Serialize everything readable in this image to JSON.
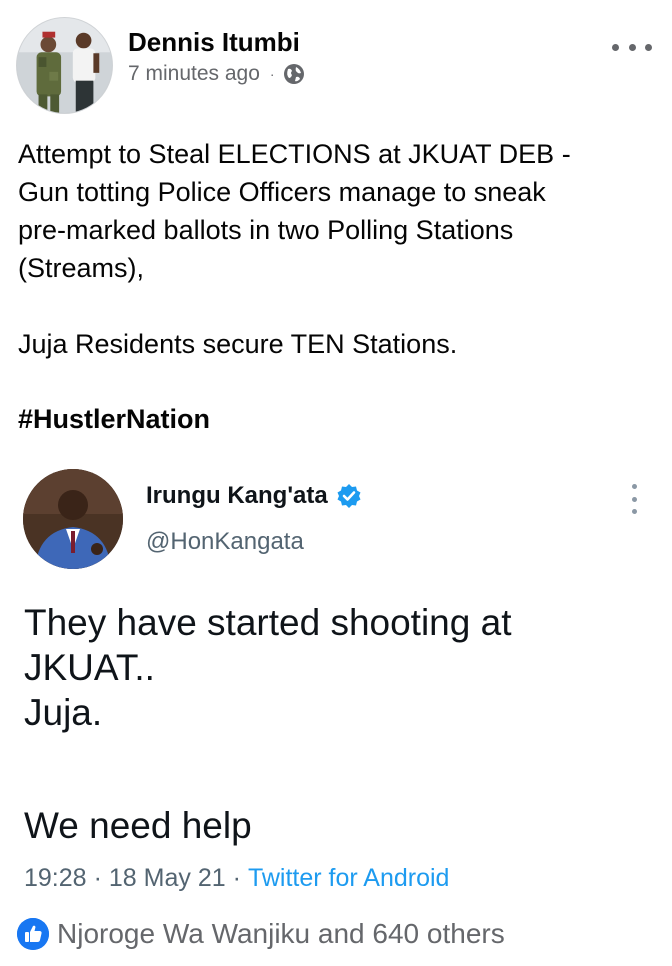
{
  "post": {
    "author": "Dennis Itumbi",
    "timestamp": "7 minutes ago",
    "separator": "·",
    "privacy_icon": "globe-icon",
    "text_lines": [
      "Attempt to Steal ELECTIONS at JKUAT DEB -",
      "Gun totting Police Officers manage to sneak",
      "pre-marked ballots in two Polling Stations",
      "(Streams),"
    ],
    "text_line2": "Juja Residents secure TEN Stations.",
    "hashtag": "#HustlerNation"
  },
  "tweet": {
    "name": "Irungu Kang'ata",
    "handle": "@HonKangata",
    "body_lines": [
      "They have started shooting at",
      "JKUAT..",
      "Juja."
    ],
    "body_last": "We need help",
    "time": "19:28",
    "date": "18 May 21",
    "sep": "·",
    "source": "Twitter for Android"
  },
  "reactions": {
    "icon": "like-icon",
    "text": "Njoroge Wa Wanjiku and 640 others"
  },
  "colors": {
    "facebook_blue": "#1877f2",
    "twitter_blue": "#1d9bf0",
    "meta_gray": "#65676b"
  }
}
